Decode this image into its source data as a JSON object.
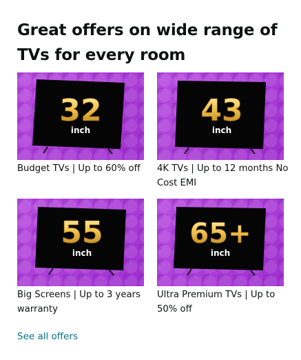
{
  "section": {
    "title": "Great offers on wide range of TVs for every room",
    "see_all_label": "See all offers"
  },
  "tiles": [
    {
      "size": "32",
      "unit": "inch",
      "label": "Budget TVs | Up to 60% off"
    },
    {
      "size": "43",
      "unit": "inch",
      "label": "4K TVs | Up to 12 months No Cost EMI"
    },
    {
      "size": "55",
      "unit": "inch",
      "label": "Big Screens | Up to 3 years warranty"
    },
    {
      "size": "65+",
      "unit": "inch",
      "label": "Ultra Premium TVs | Up to 50% off"
    }
  ],
  "colors": {
    "tile_background": "#a93fd6",
    "link": "#007185",
    "numeral_gold": "#f2c14e"
  }
}
